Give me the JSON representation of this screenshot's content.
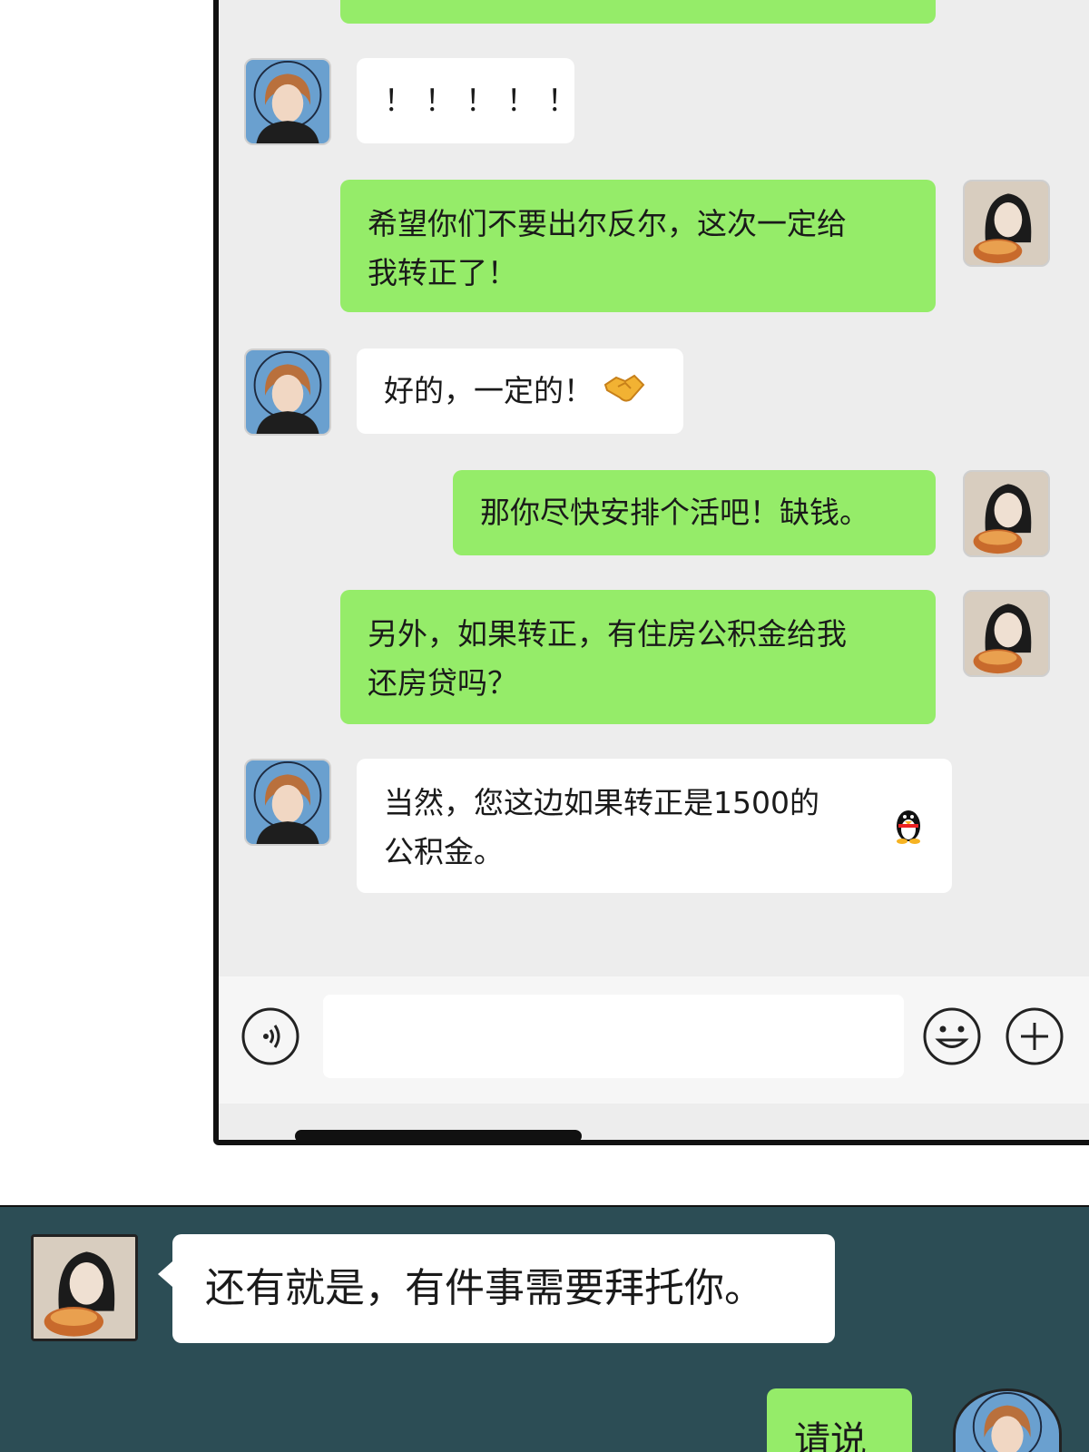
{
  "chat": {
    "messages": [
      {
        "side": "out",
        "text": ""
      },
      {
        "side": "in",
        "text": "！！！！！"
      },
      {
        "side": "out",
        "line1": "希望你们不要出尔反尔，这次一定给",
        "line2": "我转正了！"
      },
      {
        "side": "in",
        "text": "好的，一定的！",
        "emoji": "handshake-emoji"
      },
      {
        "side": "out",
        "text": "那你尽快安排个活吧！缺钱。"
      },
      {
        "side": "out",
        "line1": "另外，如果转正，有住房公积金给我",
        "line2": "还房贷吗？"
      },
      {
        "side": "in",
        "line1": "当然，您这边如果转正是1500的",
        "line2": "公积金。",
        "emoji": "penguin-emoji"
      }
    ]
  },
  "input_bar": {
    "voice_icon": "voice-icon",
    "emoji_icon": "smiley-icon",
    "more_icon": "plus-circle-icon",
    "placeholder": ""
  },
  "strip": {
    "messages": [
      {
        "side": "in",
        "text": "还有就是，有件事需要拜托你。"
      },
      {
        "side": "out",
        "text": "请说"
      }
    ]
  },
  "colors": {
    "out_bubble": "#95ec69",
    "in_bubble": "#ffffff",
    "chat_bg": "#ededed",
    "strip_bg": "#2c4d55"
  }
}
